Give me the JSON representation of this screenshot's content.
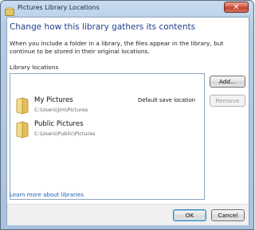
{
  "window": {
    "title": "Pictures Library Locations",
    "close_glyph": "✕"
  },
  "header": {
    "heading": "Change how this library gathers its contents",
    "description": "When you include a folder in a library, the files appear in the library, but continue to be stored in their original locations."
  },
  "locations": {
    "label": "Library locations",
    "items": [
      {
        "name": "My Pictures",
        "path": "C:\\Users\\Jim\\Pictures",
        "badge": "Default save location",
        "icon": "folder-icon"
      },
      {
        "name": "Public Pictures",
        "path": "C:\\Users\\Public\\Pictures",
        "badge": "",
        "icon": "folder-icon"
      }
    ]
  },
  "buttons": {
    "add": "Add...",
    "remove": "Remove",
    "ok": "OK",
    "cancel": "Cancel"
  },
  "link": {
    "text": "Learn more about libraries"
  },
  "colors": {
    "heading": "#1e3e8a",
    "link": "#1c5fb5",
    "folder": "#e8c76a"
  }
}
